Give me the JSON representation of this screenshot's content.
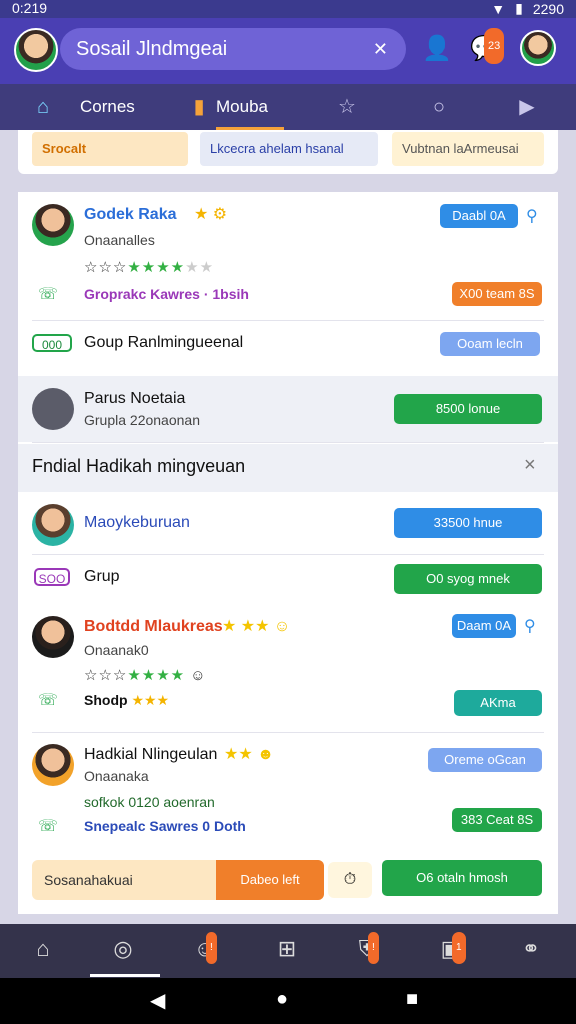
{
  "status": {
    "time": "0:219",
    "right": "2290"
  },
  "header": {
    "app_title": "Sosail Jlndmgeai",
    "close_glyph": "✕"
  },
  "top_badge": "23",
  "tabs": [
    {
      "label": "Cornes"
    },
    {
      "label": "Mouba"
    }
  ],
  "filters": [
    {
      "label": "Srocalt"
    },
    {
      "label": "Lkcecra ahelam hsanal"
    },
    {
      "label": "Vubtnan laArmeusai"
    }
  ],
  "rows": [
    {
      "name": "Godek Raka",
      "sub": "Onaanalles",
      "line": "Groprakc Kawres · 1bsih",
      "button": "Daabl 0A",
      "button2": "X00 team 8S"
    },
    {
      "tag": "000",
      "title": "Goup Ranlmingueenal",
      "button": "Ooam lecln"
    },
    {
      "name": "Parus Noetaia",
      "sub": "Grupla 22onaonan",
      "button": "8500 lonue"
    },
    {
      "title": "Fndial Hadikah mingveuan",
      "close": "×"
    },
    {
      "name": "Maoykeburuan",
      "button": "33500 hnue"
    },
    {
      "tag": "SOO",
      "title": "Grup",
      "button": "O0 syog mnek"
    },
    {
      "name": "Bodtdd Mlaukreas",
      "sub": "Onaanak0",
      "line": "Shodp",
      "button": "Daam 0A",
      "button2": "AKma"
    },
    {
      "name": "Hadkial Nlingeulan",
      "sub": "Onaanaka",
      "line": "sofkok 0120 aoenran",
      "line2": "Snepealc Sawres 0 Doth",
      "button": "Oreme oGcan",
      "button2": "383 Ceat 8S"
    },
    {
      "input": "Sosanahakuai",
      "button": "Dabeo left",
      "button2": "O6 otaln hmosh"
    }
  ],
  "bottom_nav": [
    {
      "icon": "home-icon"
    },
    {
      "icon": "location-icon"
    },
    {
      "icon": "people-icon"
    },
    {
      "icon": "inbox-icon"
    },
    {
      "icon": "shield-icon"
    },
    {
      "icon": "camera-icon"
    },
    {
      "icon": "group-icon"
    }
  ],
  "nav_badges": [
    "!",
    "!",
    "1"
  ]
}
